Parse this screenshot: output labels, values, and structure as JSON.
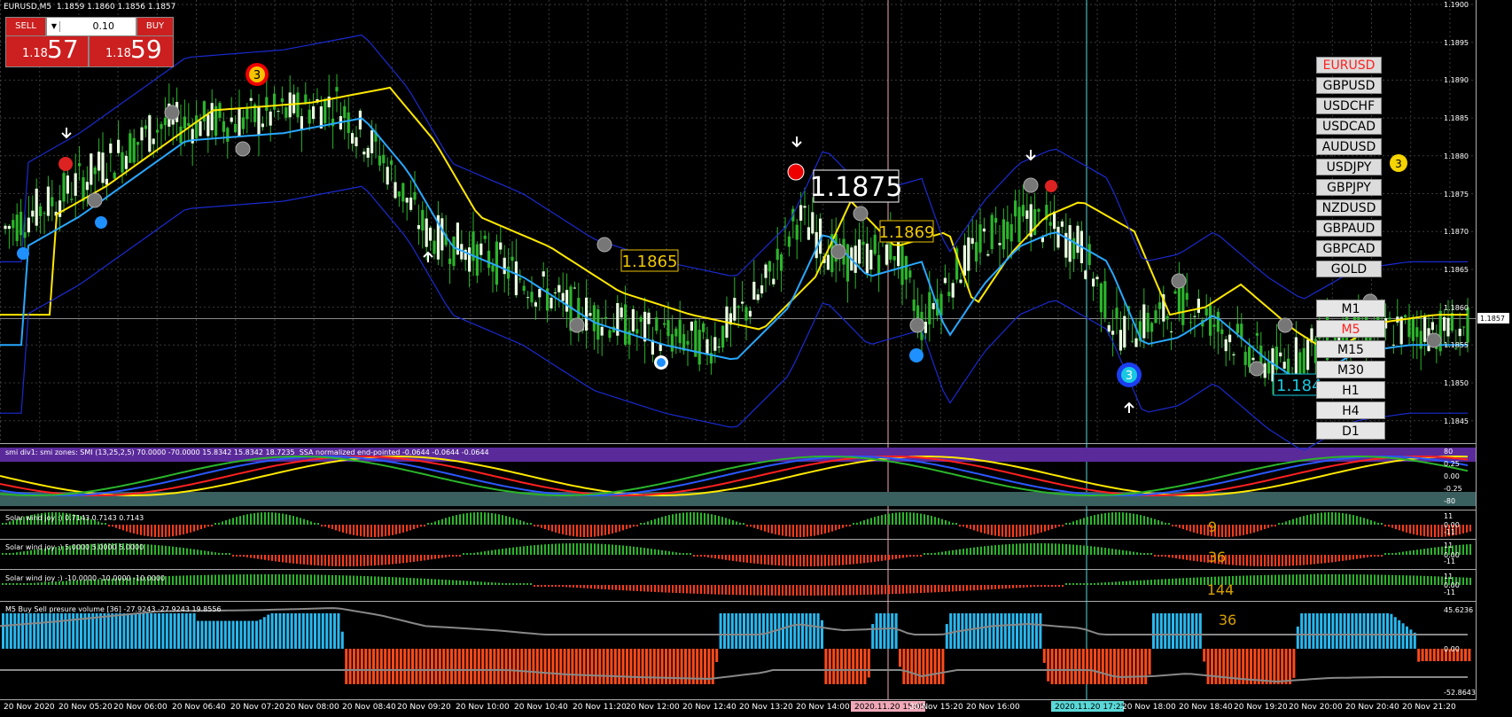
{
  "window": {
    "title": "EURUSD,M5  1.1859 1.1860 1.1856 1.1857"
  },
  "trade_panel": {
    "sell_label": "SELL",
    "buy_label": "BUY",
    "lot_value": "0.10",
    "sell_small": "1.18",
    "sell_big": "57",
    "buy_small": "1.18",
    "buy_big": "59"
  },
  "symbols": {
    "items": [
      "EURUSD",
      "GBPUSD",
      "USDCHF",
      "USDCAD",
      "AUDUSD",
      "USDJPY",
      "GBPJPY",
      "NZDUSD",
      "GBPAUD",
      "GBPCAD",
      "GOLD"
    ],
    "active": "EURUSD"
  },
  "timeframes": {
    "items": [
      "M1",
      "M5",
      "M15",
      "M30",
      "H1",
      "H4",
      "D1"
    ],
    "active": "M5"
  },
  "indicators": {
    "smi": "smi div1: smi zones: SMI (13,25,2,5) 70.0000 -70.0000 15.8342 15.8342 18.7235  SSA normalized end-pointed -0.0644 -0.0644 -0.0644",
    "solar1": "Solar wind joy :) 0.7143 0.7143 0.7143",
    "solar2": "Solar wind joy :) 5.0000 5.0000 5.0000",
    "solar3": "Solar wind joy :) -10.0000 -10.0000 -10.0000",
    "volume": "M5 Buy Sell presure volume [36] -27.9243 -27.9243 19.8556"
  },
  "price_axis": [
    "1.1900",
    "1.1895",
    "1.1890",
    "1.1885",
    "1.1880",
    "1.1875",
    "1.1870",
    "1.1865",
    "1.1860",
    "1.1855",
    "1.1850",
    "1.1845"
  ],
  "current_price": "1.1857",
  "smi_axis": [
    "80",
    "0.25",
    "0.00",
    "-0.25",
    "-80"
  ],
  "solar_axis": [
    "11",
    "0.00",
    "-11"
  ],
  "volume_axis": [
    "45.6236",
    "0.00",
    "-52.8643"
  ],
  "time_axis": [
    "20 Nov 2020",
    "20 Nov 05:20",
    "20 Nov 06:00",
    "20 Nov 06:40",
    "20 Nov 07:20",
    "20 Nov 08:00",
    "20 Nov 08:40",
    "20 Nov 09:20",
    "20 Nov 10:00",
    "20 Nov 10:40",
    "20 Nov 11:20",
    "20 Nov 12:00",
    "20 Nov 12:40",
    "20 Nov 13:20",
    "20 Nov 14:00",
    "2020.11.20 15:05",
    "20 Nov 15:20",
    "20 Nov 16:00",
    "2020.11.20 17:25",
    "20 Nov 18:00",
    "20 Nov 18:40",
    "20 Nov 19:20",
    "20 Nov 20:00",
    "20 Nov 20:40",
    "20 Nov 21:20"
  ],
  "annotations": {
    "big_price": "1.1875",
    "price_1869": "1.1869",
    "price_1865": "1.1865",
    "price_184": "1.184",
    "marker_3_top": "3",
    "marker_3_bottom": "3",
    "marker_3_right": "3",
    "solar_9": "9",
    "solar_36": "36",
    "solar_144": "144",
    "volume_36": "36"
  }
}
